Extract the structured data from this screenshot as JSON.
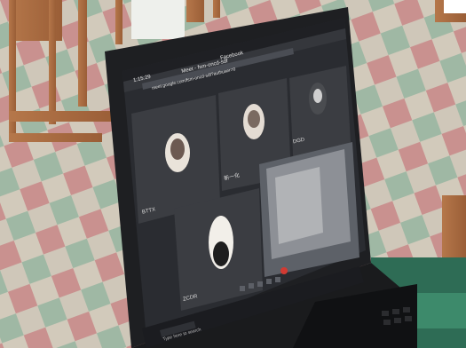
{
  "browser": {
    "tabs": [
      {
        "label": "1:15:29"
      },
      {
        "label": "Meet - fsm-oncd-sdf"
      },
      {
        "label": "Facebook"
      }
    ],
    "address": "meet.google.com/fsm-oncd-sdf?authuser=0"
  },
  "meet": {
    "participants": [
      {
        "name": "BTTX"
      },
      {
        "name": "新一化"
      },
      {
        "name": "DGD"
      },
      {
        "name": "ZCDR"
      }
    ]
  },
  "taskbar": {
    "search_placeholder": "Type here to search"
  },
  "icons": [
    "mic-icon",
    "camera-icon",
    "hand-icon",
    "present-icon",
    "more-icon",
    "end-call-icon"
  ]
}
